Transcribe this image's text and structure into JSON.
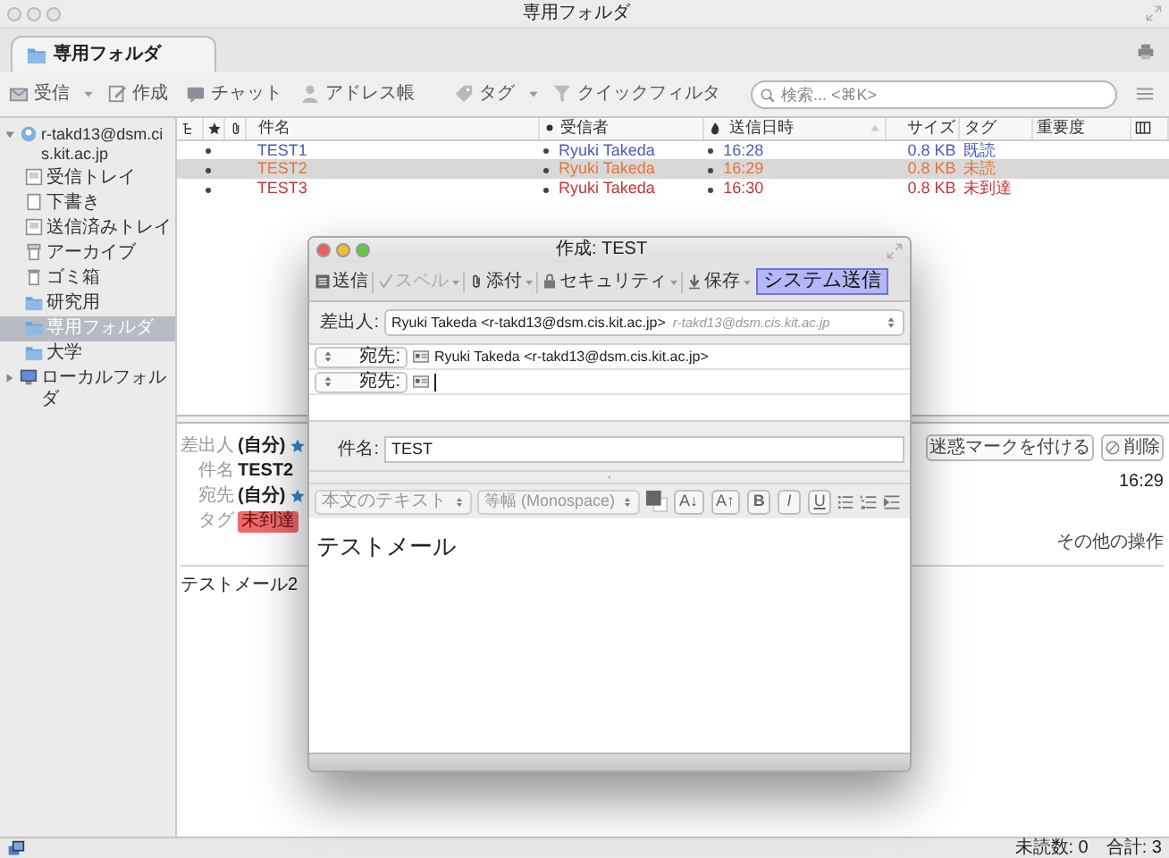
{
  "window": {
    "title": "専用フォルダ"
  },
  "tabs": [
    {
      "label": "専用フォルダ",
      "selected": true
    }
  ],
  "toolbar": [
    {
      "label": "受信",
      "dropdown": true
    },
    {
      "label": "作成",
      "dropdown": false
    },
    {
      "label": "チャット",
      "dropdown": false
    },
    {
      "label": "アドレス帳",
      "dropdown": false
    },
    {
      "label": "タグ",
      "dropdown": true
    },
    {
      "label": "クイックフィルタ",
      "dropdown": false
    }
  ],
  "search": {
    "placeholder": "検索... <⌘K>"
  },
  "folder_tree": [
    {
      "label": "r-takd13@dsm.cis.kit.ac.jp",
      "expanded": true,
      "selected": false,
      "children": [
        {
          "label": "受信トレイ",
          "selected": false
        },
        {
          "label": "下書き",
          "selected": false
        },
        {
          "label": "送信済みトレイ",
          "selected": false
        },
        {
          "label": "アーカイブ",
          "selected": false
        },
        {
          "label": "ゴミ箱",
          "selected": false
        },
        {
          "label": "研究用",
          "selected": false
        },
        {
          "label": "専用フォルダ",
          "selected": true
        },
        {
          "label": "大学",
          "selected": false
        }
      ]
    },
    {
      "label": "ローカルフォルダ",
      "expanded": false,
      "selected": false
    }
  ],
  "message_list": {
    "columns": [
      "件名",
      "受信者",
      "送信日時",
      "サイズ",
      "タグ",
      "重要度"
    ],
    "rows": [
      {
        "subject": "TEST1",
        "recipient": "Ryuki Takeda",
        "date": "16:28",
        "size": "0.8 KB",
        "tag": "既読",
        "color": "#4b5bb8",
        "selected": false
      },
      {
        "subject": "TEST2",
        "recipient": "Ryuki Takeda",
        "date": "16:29",
        "size": "0.8 KB",
        "tag": "未読",
        "color": "#e8733a",
        "selected": true
      },
      {
        "subject": "TEST3",
        "recipient": "Ryuki Takeda",
        "date": "16:30",
        "size": "0.8 KB",
        "tag": "未到達",
        "color": "#cc3333",
        "selected": false
      }
    ]
  },
  "preview": {
    "fields": [
      {
        "label": "差出人",
        "value": "(自分)",
        "kind": "contact"
      },
      {
        "label": "件名",
        "value": "TEST2",
        "kind": "text"
      },
      {
        "label": "宛先",
        "value": "(自分)",
        "kind": "contact"
      },
      {
        "label": "タグ",
        "value": "未到達",
        "kind": "tag"
      }
    ],
    "buttons": [
      {
        "label": "迷惑マークを付ける",
        "kind": "junk"
      },
      {
        "label": "削除",
        "kind": "delete"
      }
    ],
    "time": "16:29",
    "more": "その他の操作",
    "body": "テストメール2"
  },
  "compose": {
    "title": "作成: TEST",
    "toolbar": [
      {
        "label": "送信",
        "dropdown": false,
        "disabled": false
      },
      {
        "label": "スペル",
        "dropdown": true,
        "disabled": true
      },
      {
        "label": "添付",
        "dropdown": true,
        "disabled": false
      },
      {
        "label": "セキュリティ",
        "dropdown": true,
        "disabled": false
      },
      {
        "label": "保存",
        "dropdown": true,
        "disabled": false
      }
    ],
    "custom_button": "システム送信",
    "from": {
      "label": "差出人:",
      "value": "Ryuki Takeda <r-takd13@dsm.cis.kit.ac.jp>",
      "hint": "r-takd13@dsm.cis.kit.ac.jp"
    },
    "recipients": [
      {
        "type": "宛先:",
        "value": "Ryuki Takeda <r-takd13@dsm.cis.kit.ac.jp>"
      },
      {
        "type": "宛先:"
      }
    ],
    "subject": {
      "label": "件名:",
      "value": "TEST"
    },
    "format": {
      "paragraph": "本文のテキスト",
      "font": "等幅 (Monospace)",
      "buttons": [
        {
          "label": "A↓",
          "kind": "smaller"
        },
        {
          "label": "A↑",
          "kind": "larger"
        },
        {
          "label": "B",
          "kind": "bold"
        },
        {
          "label": "I",
          "kind": "italic"
        },
        {
          "label": "U",
          "kind": "underline"
        }
      ]
    },
    "body": "テストメール"
  },
  "status_bar": {
    "unread": "未読数: 0",
    "total": "合計: 3"
  }
}
